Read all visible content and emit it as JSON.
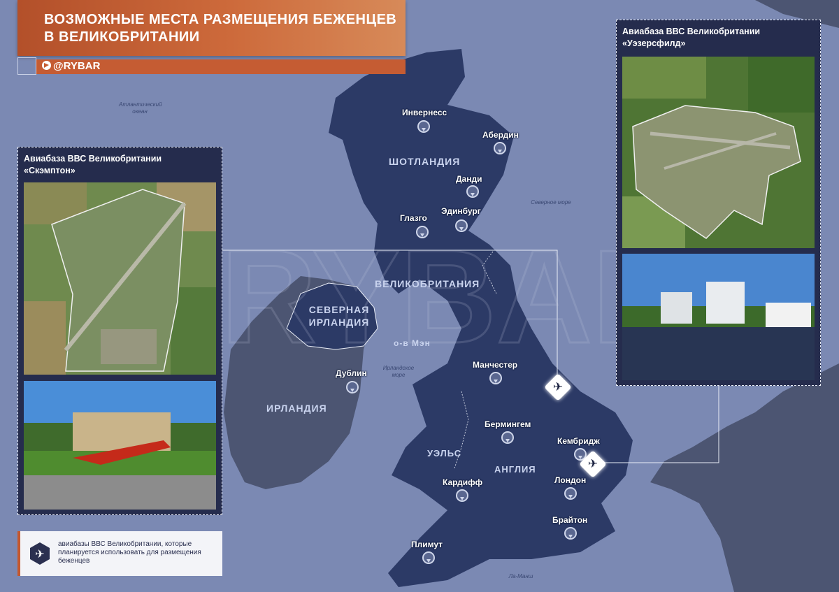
{
  "header": {
    "title_line1": "ВОЗМОЖНЫЕ МЕСТА РАЗМЕЩЕНИЯ БЕЖЕНЦЕВ",
    "title_line2": "В ВЕЛИКОБРИТАНИИ",
    "brand": "@RYBAR",
    "brand_icon": "telegram-icon"
  },
  "watermark": "RYBAR",
  "seas": {
    "atlantic": "Атлантический океан",
    "north": "Северное море",
    "irish": "Ирландское море",
    "channel": "Ла-Манш"
  },
  "regions": {
    "scotland": "ШОТЛАНДИЯ",
    "great_britain": "ВЕЛИКОБРИТАНИЯ",
    "northern_ireland": "СЕВЕРНАЯ ИРЛАНДИЯ",
    "isle_of_man": "о-в Мэн",
    "ireland": "ИРЛАНДИЯ",
    "wales": "УЭЛЬС",
    "england": "АНГЛИЯ"
  },
  "cities": {
    "inverness": "Инвернесс",
    "aberdeen": "Абердин",
    "dundee": "Данди",
    "edinburgh": "Эдинбург",
    "glasgow": "Глазго",
    "dublin": "Дублин",
    "manchester": "Манчестер",
    "birmingham": "Бермингем",
    "cambridge": "Кембридж",
    "london": "Лондон",
    "cardiff": "Кардифф",
    "brighton": "Брайтон",
    "plymouth": "Плимут"
  },
  "airbases": [
    {
      "title_line1": "Авиабаза ВВС Великобритании",
      "title_line2": "«Скэмптон»",
      "icon": "airplane-icon"
    },
    {
      "title_line1": "Авиабаза ВВС Великобритании",
      "title_line2": "«Уэзерсфилд»",
      "icon": "airplane-icon"
    }
  ],
  "legend": {
    "icon": "airplane-marker-icon",
    "text": "авиабазы ВВС Великобритании, которые планируется использовать для размещения беженцев"
  },
  "colors": {
    "sea": "#7b89b3",
    "land_uk": "#2c3a66",
    "land_other": "#4c5572",
    "accent": "#c4582f",
    "panel": "#252c4d"
  }
}
